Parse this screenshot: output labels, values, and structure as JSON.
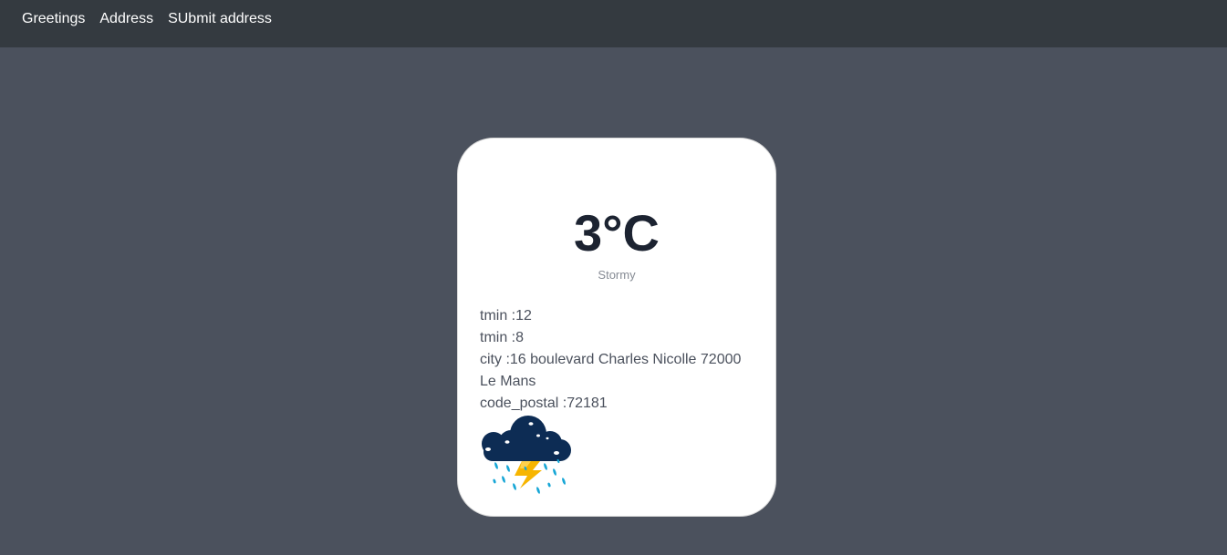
{
  "nav": {
    "items": [
      {
        "label": "Greetings"
      },
      {
        "label": "Address"
      },
      {
        "label": "SUbmit address"
      }
    ]
  },
  "weather": {
    "temperature": "3°C",
    "condition": "Stormy",
    "details": {
      "tmin_label": "tmin :",
      "tmin_value": "12",
      "tmax_label": "tmin :",
      "tmax_value": "8",
      "city_label": "city :",
      "city_value": "16 boulevard Charles Nicolle 72000 Le Mans",
      "postal_label": "code_postal :",
      "postal_value": "72181"
    },
    "icon": "storm-cloud-icon"
  }
}
